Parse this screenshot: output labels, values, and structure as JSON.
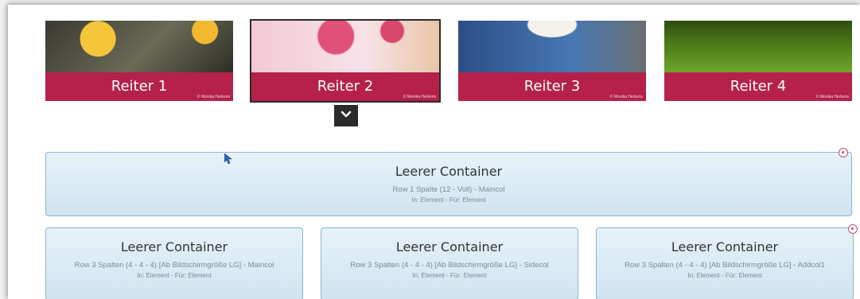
{
  "tabs": [
    {
      "label": "Reiter 1",
      "credit": "© Monika Herkens"
    },
    {
      "label": "Reiter 2",
      "credit": "© Monika Herkens"
    },
    {
      "label": "Reiter 3",
      "credit": "© Monika Herkens"
    },
    {
      "label": "Reiter 4",
      "credit": "© Monika Herkens"
    }
  ],
  "active_tab": "Reiter 2",
  "containers": {
    "full": {
      "title": "Leerer Container",
      "description": "Row 1 Spalte (12 - Voll) - Maincol",
      "meta": "In: Element - Für: Element"
    },
    "main": {
      "title": "Leerer Container",
      "description": "Row 3 Spalten (4 - 4 - 4) [Ab Bildschirmgröße LG] - Maincol",
      "meta": "In: Element - Für: Element"
    },
    "side": {
      "title": "Leerer Container",
      "description": "Row 3 Spalten (4 - 4 - 4) [Ab Bildschirmgröße LG] - Sidecol",
      "meta": "In: Element - Für: Element"
    },
    "add": {
      "title": "Leerer Container",
      "description": "Row 3 Spalten (4 - 4 - 4) [Ab Bildschirmgröße LG] - Addcol1",
      "meta": "In: Element - Für: Element"
    }
  },
  "icons": {
    "expand": "chevron-down-icon",
    "element_target": "target-icon",
    "cursor": "mouse-pointer-icon"
  },
  "colors": {
    "tab_bar": "#b5214a",
    "container_bg": "#d9ebf5",
    "container_border": "#8bb6cc",
    "target": "#c34a6a"
  }
}
